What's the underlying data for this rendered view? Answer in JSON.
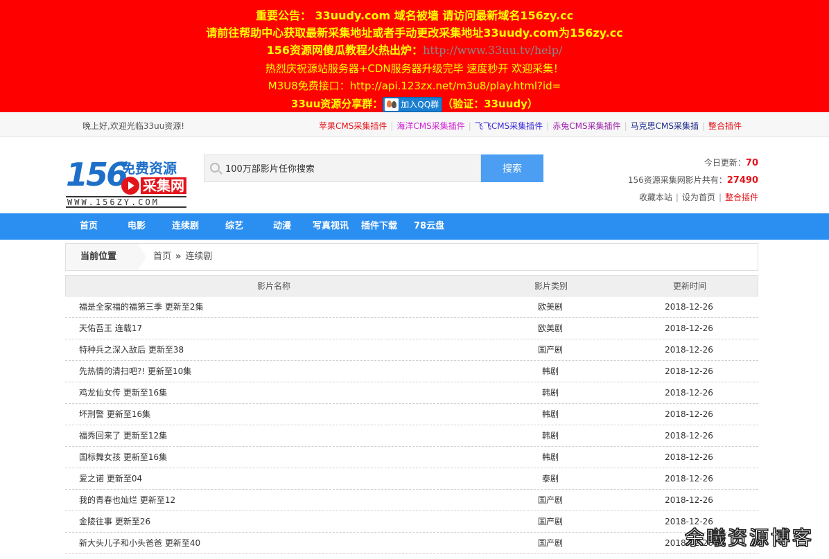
{
  "notice": {
    "line1": "重要公告： 33uudy.com 域名被墙 请访问最新域名156zy.cc",
    "line2": "请前往帮助中心获取最新采集地址或者手动更改采集地址33uudy.com为156zy.cc",
    "line3_prefix": "156资源网傻瓜教程火热出炉：",
    "line3_link": "http://www.33uu.tv/help/",
    "line4": "热烈庆祝源站服务器+CDN服务器升级完毕 速度秒开 欢迎采集！",
    "line5": "M3U8免费接口：http://api.123zx.net/m3u8/play.html?id=",
    "line6_prefix": "33uu资源分享群：",
    "qq_button": "加入QQ群",
    "line6_suffix": "（验证：33uudy）",
    "color_bg": "#ff0000",
    "color_text": "#ffff00"
  },
  "topbar": {
    "greeting": "晚上好,欢迎光临33uu资源!",
    "links": [
      {
        "label": "苹果CMS采集插件",
        "color": "#e4141b"
      },
      {
        "label": "海洋CMS采集插件",
        "color": "#d11fd1"
      },
      {
        "label": "飞飞CMS采集插件",
        "color": "#3b2ad6"
      },
      {
        "label": "赤兔CMS采集插件",
        "color": "#9b1fa8"
      },
      {
        "label": "马克思CMS采集插",
        "color": "#1a2a8a"
      },
      {
        "label": "整合插件",
        "color": "#e4141b"
      }
    ]
  },
  "logo": {
    "number": "156",
    "title": "免费资源",
    "subtitle": "采集网",
    "url": "WWW.156ZY.COM"
  },
  "search": {
    "placeholder": "100万部影片任你搜索",
    "button": "搜索"
  },
  "stats": {
    "today_label": "今日更新：",
    "today_value": "70",
    "total_label": "156资源采集网影片共有：",
    "total_value": "27490",
    "bookmark": "收藏本站",
    "homepage": "设为首页",
    "plugins": "整合插件"
  },
  "nav": {
    "items": [
      "首页",
      "电影",
      "连续剧",
      "综艺",
      "动漫",
      "写真视讯",
      "插件下载",
      "78云盘"
    ]
  },
  "breadcrumb": {
    "current_label": "当前位置",
    "home": "首页",
    "separator": "»",
    "section": "连续剧"
  },
  "table": {
    "headers": [
      "影片名称",
      "影片类别",
      "更新时间"
    ],
    "rows": [
      {
        "name": "福是全家福的福第三季 更新至2集",
        "category": "欧美剧",
        "date": "2018-12-26"
      },
      {
        "name": "天佑吾王 连载17",
        "category": "欧美剧",
        "date": "2018-12-26"
      },
      {
        "name": "特种兵之深入敌后 更新至38",
        "category": "国产剧",
        "date": "2018-12-26"
      },
      {
        "name": "先热情的清扫吧?! 更新至10集",
        "category": "韩剧",
        "date": "2018-12-26"
      },
      {
        "name": "鸡龙仙女传 更新至16集",
        "category": "韩剧",
        "date": "2018-12-26"
      },
      {
        "name": "坏刑警 更新至16集",
        "category": "韩剧",
        "date": "2018-12-26"
      },
      {
        "name": "福秀回来了 更新至12集",
        "category": "韩剧",
        "date": "2018-12-26"
      },
      {
        "name": "国标舞女孩 更新至16集",
        "category": "韩剧",
        "date": "2018-12-26"
      },
      {
        "name": "爱之诺 更新至04",
        "category": "泰剧",
        "date": "2018-12-26"
      },
      {
        "name": "我的青春也灿烂 更新至12",
        "category": "国产剧",
        "date": "2018-12-26"
      },
      {
        "name": "金陵往事 更新至26",
        "category": "国产剧",
        "date": "2018-12-26"
      },
      {
        "name": "新大头儿子和小头爸爸 更新至40",
        "category": "国产剧",
        "date": "2018-12-26"
      }
    ]
  },
  "watermark": "余曦资源博客"
}
